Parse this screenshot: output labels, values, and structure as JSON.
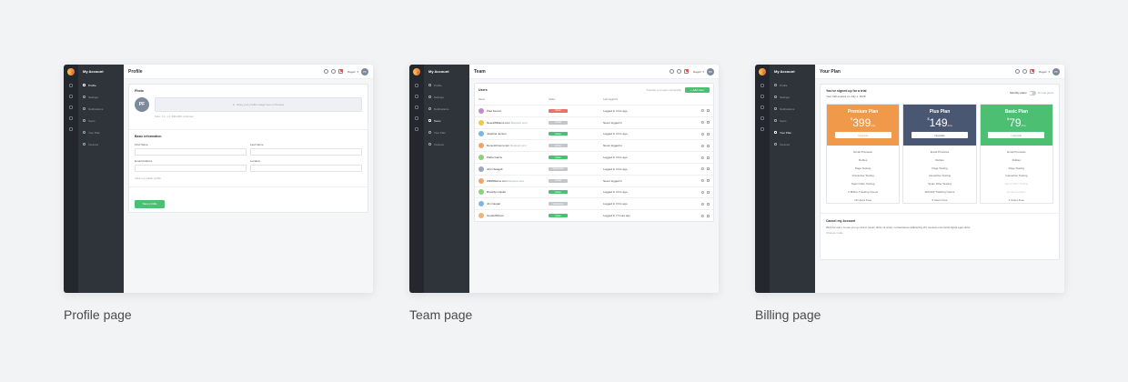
{
  "common": {
    "account_title": "My Account",
    "user_name": "Ragell",
    "avatar_initials": "PF",
    "nav": [
      "Profile",
      "Settings",
      "Notifications",
      "Team",
      "Your Plan",
      "Invoices"
    ]
  },
  "profile": {
    "page_title": "Profile",
    "photo_section": "Photo",
    "avatar_initials": "PF",
    "drop_text": "Drag your profile image here or browse",
    "drop_hint": "Size: 1:1, 1:1 300x300 minimum",
    "basic_info": "Basic information",
    "first_name_label": "First Name",
    "last_name_label": "Last Name",
    "email_label": "Email Address",
    "location_label": "Location",
    "view_public": "View my public profile",
    "save_label": "Save profile",
    "caption": "Profile page"
  },
  "team": {
    "page_title": "Team",
    "users_title": "Users",
    "transfer_text": "Transfer to project ownership",
    "add_user": "+ Add User",
    "col_name": "Name",
    "col_status": "Status",
    "col_last_login": "Last logged in",
    "members": [
      {
        "name": "Paul Ferrett",
        "status": "Admin",
        "login": "Logged in 3 hrs ago",
        "color": "#c58ad0",
        "badge": "#e8736a"
      },
      {
        "name": "NeeraWilliams.com",
        "note": "Request sent",
        "status": "Invited",
        "login": "Never logged in",
        "color": "#f0c74a",
        "badge": "#c3c7cc"
      },
      {
        "name": "Josefina Jensen",
        "status": "Active",
        "login": "Logged in 3 hrs ago",
        "color": "#7cb5e8",
        "badge": "#4cbf73"
      },
      {
        "name": "DenoJohnson.com",
        "note": "Request sent",
        "status": "Invited",
        "login": "Never logged in",
        "color": "#f0a46a",
        "badge": "#c3c7cc"
      },
      {
        "name": "Pablo Garza",
        "status": "Active",
        "login": "Logged in 3 hrs ago",
        "color": "#8cd07a",
        "badge": "#4cbf73"
      },
      {
        "name": "John Seagelt",
        "status": "Suspended",
        "login": "Logged in 3 hrs ago",
        "color": "#9aa8c0",
        "badge": "#c3c7cc"
      },
      {
        "name": "WillWilliams.com",
        "note": "Request sent",
        "status": "Invited",
        "login": "Never logged in",
        "color": "#f0a46a",
        "badge": "#c3c7cc"
      },
      {
        "name": "Brooklyn Castle",
        "status": "Active",
        "login": "Logged in 3 hrs ago",
        "color": "#8cd07a",
        "badge": "#4cbf73"
      },
      {
        "name": "Jim Caspar",
        "status": "Suspended",
        "login": "Logged in 3 hrs ago",
        "color": "#7cb5e8",
        "badge": "#c3c7cc"
      },
      {
        "name": "GoodeWinson",
        "status": "Active",
        "login": "Logged in 7 hours ago",
        "color": "#f0b27a",
        "badge": "#4cbf73"
      }
    ],
    "caption": "Team page"
  },
  "billing": {
    "page_title": "Your Plan",
    "signed_up": "You've signed up for a trial",
    "trial_expires": "Your trial expires on July 1, 2018",
    "monthly_label": "Monthly plans",
    "annual_label": "Annual plans",
    "plans": [
      {
        "name": "Premium Plan",
        "price": "399",
        "per": "/mo",
        "button": "Upgrade",
        "color": "#f0994a",
        "features": [
          "Email Previews",
          "Rubles",
          "Page Testing",
          "Interactive Testing",
          "Spam Filter Testing",
          "2 Million Tracking Opens",
          "10 Users Free"
        ]
      },
      {
        "name": "Plus Plan",
        "price": "149",
        "per": "/mo",
        "button": "Upgrade",
        "color": "#4a5773",
        "features": [
          "Email Previews",
          "Rubles",
          "Page Testing",
          "Interactive Testing",
          "Spam Filter Testing",
          "200,000 Tracking Opens",
          "2 Users Free"
        ]
      },
      {
        "name": "Basic Plan",
        "price": "79",
        "per": "/mo",
        "button": "Upgrade",
        "color": "#4cbf73",
        "features": [
          "Email Previews",
          "Rubles",
          "Page Testing",
          "Interactive Testing",
          "Spam Filter Testing",
          "Email Analytics",
          "2 Users Free"
        ]
      }
    ],
    "cancel_title": "Cancel my Account",
    "cancel_text": "We'll be sorry to see you go lorem ipsum dolor sit amet, consectetuer adipiscing elit. Aenean commodo ligula eget dolor.",
    "cancel_link": "Change mode",
    "caption": "Billing page"
  }
}
